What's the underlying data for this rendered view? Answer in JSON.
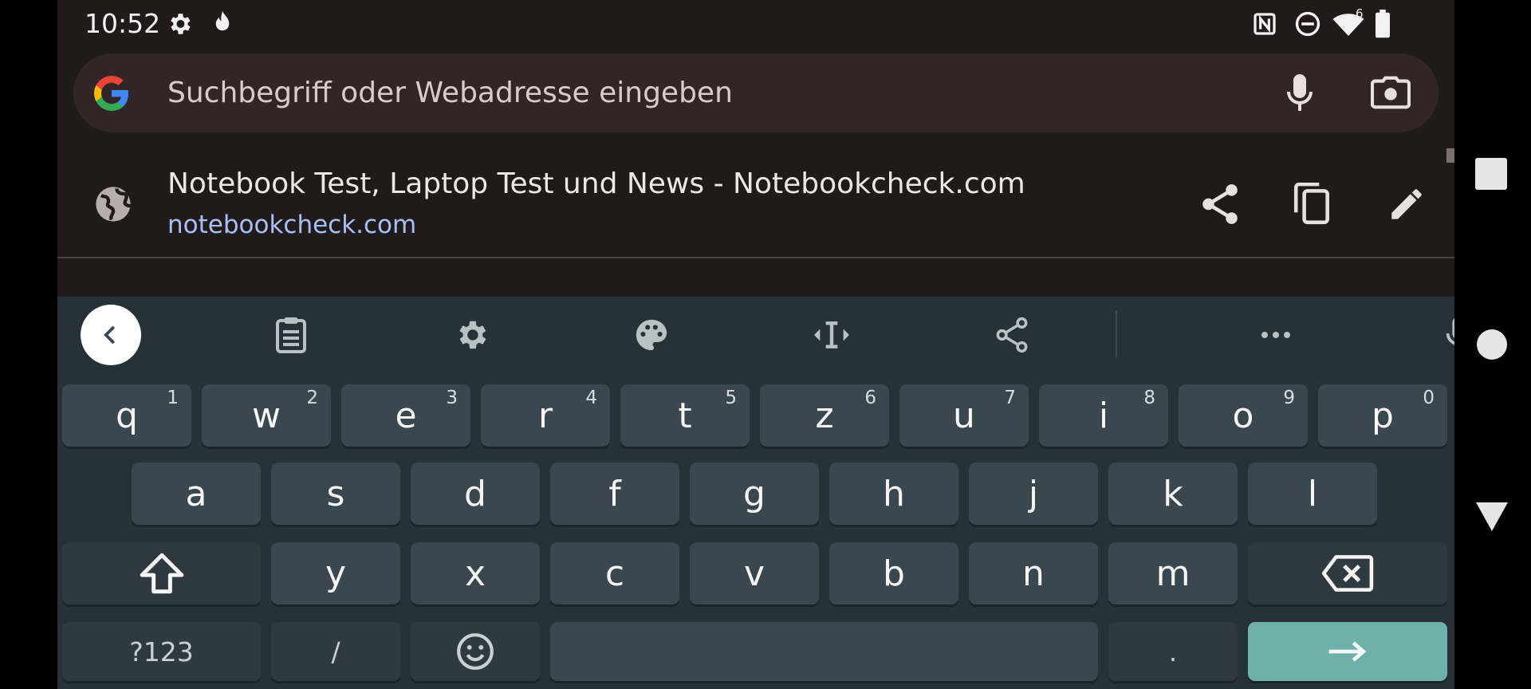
{
  "status_bar": {
    "time": "10:52",
    "left_icons": [
      "gear-icon",
      "flame-icon"
    ],
    "right_icons": [
      "nfc-icon",
      "do-not-disturb-icon",
      "wifi-icon",
      "battery-icon"
    ],
    "wifi_badge": "6"
  },
  "search": {
    "placeholder": "Suchbegriff oder Webadresse eingeben",
    "left_icon": "google-logo",
    "actions": [
      "microphone-icon",
      "camera-icon"
    ]
  },
  "suggestion": {
    "title": "Notebook Test, Laptop Test und News - Notebookcheck.com",
    "url": "notebookcheck.com",
    "actions": [
      "share-icon",
      "copy-icon",
      "edit-icon"
    ]
  },
  "keyboard": {
    "toolbar": [
      "back-icon",
      "clipboard-icon",
      "settings-icon",
      "palette-icon",
      "cursor-icon",
      "share-icon",
      "more-icon",
      "microphone-icon"
    ],
    "row1": [
      {
        "label": "q",
        "hint": "1"
      },
      {
        "label": "w",
        "hint": "2"
      },
      {
        "label": "e",
        "hint": "3"
      },
      {
        "label": "r",
        "hint": "4"
      },
      {
        "label": "t",
        "hint": "5"
      },
      {
        "label": "z",
        "hint": "6"
      },
      {
        "label": "u",
        "hint": "7"
      },
      {
        "label": "i",
        "hint": "8"
      },
      {
        "label": "o",
        "hint": "9"
      },
      {
        "label": "p",
        "hint": "0"
      }
    ],
    "row2": [
      "a",
      "s",
      "d",
      "f",
      "g",
      "h",
      "j",
      "k",
      "l"
    ],
    "row3": [
      "y",
      "x",
      "c",
      "v",
      "b",
      "n",
      "m"
    ],
    "symbols_label": "?123",
    "slash_label": "/",
    "period_label": ".",
    "accent_color": "#6eb0aa"
  },
  "navigation_bar": [
    "recents-icon",
    "home-icon",
    "back-icon"
  ]
}
